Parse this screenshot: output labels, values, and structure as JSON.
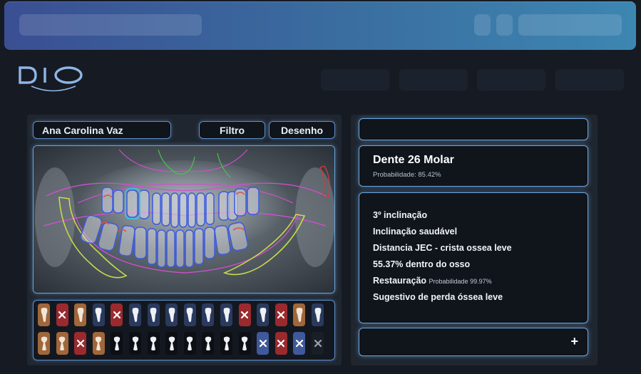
{
  "patient": {
    "name": "Ana Carolina Vaz"
  },
  "toolbar": {
    "filter_label": "Filtro",
    "draw_label": "Desenho"
  },
  "tooth_info": {
    "title": "Dente 26 Molar",
    "probability": "Probabilidade: 85.42%"
  },
  "findings": {
    "line1": "3º inclinação",
    "line2": "Inclinação saudável",
    "line3": "Distancia JEC - crista ossea leve",
    "line4": "55.37% dentro do osso",
    "line5_main": "Restauração",
    "line5_prob": "Probabilidade 99.97%",
    "line6": "Sugestivo de perda óssea leve"
  },
  "add_button": {
    "label": "+"
  },
  "icons": {
    "logo": "dio-logo",
    "add": "plus-icon",
    "missing": "x-icon",
    "tooth": "tooth-icon"
  },
  "colors": {
    "restoration": "#a0673a",
    "missing": "#9a2a2e",
    "implant": "#3f5a9a",
    "normal_upper": "#2a3a5e",
    "normal_lower": "#0c0f14",
    "accent": "#6aa6de"
  },
  "tooth_chart": {
    "upper": [
      "restoration",
      "missing",
      "restoration",
      "normal",
      "missing",
      "normal",
      "normal",
      "normal",
      "normal",
      "normal",
      "normal",
      "missing",
      "normal",
      "missing",
      "restoration",
      "normal"
    ],
    "lower": [
      "restoration",
      "restoration",
      "missing",
      "restoration",
      "normal",
      "normal",
      "normal",
      "normal",
      "normal",
      "normal",
      "normal",
      "normal",
      "implant",
      "missing",
      "implant",
      "absent"
    ]
  }
}
